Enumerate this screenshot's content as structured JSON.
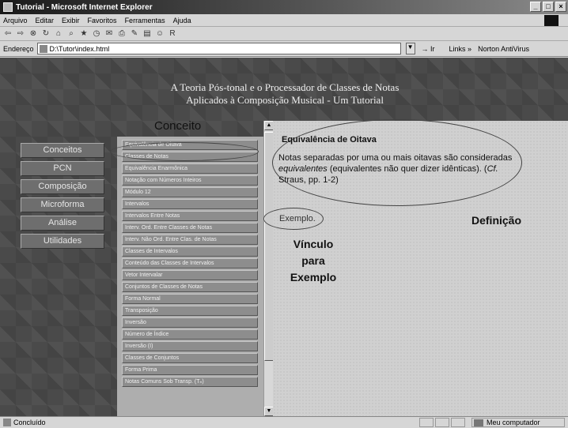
{
  "window": {
    "title": "Tutorial - Microsoft Internet Explorer",
    "controls": [
      "_",
      "□",
      "×"
    ]
  },
  "menu": [
    "Arquivo",
    "Editar",
    "Exibir",
    "Favoritos",
    "Ferramentas",
    "Ajuda"
  ],
  "toolbar": {
    "icons": [
      "back-icon",
      "forward-icon",
      "stop-icon",
      "refresh-icon",
      "home-icon",
      "search-icon",
      "favorites-icon",
      "history-icon",
      "mail-icon",
      "print-icon",
      "edit-icon",
      "discuss-icon",
      "messenger-icon",
      "research-icon"
    ]
  },
  "address": {
    "label": "Endereço",
    "url": "D:\\Tutor\\index.html",
    "go_label": "Ir",
    "links_label": "Links »",
    "norton_label": "Norton AntiVirus"
  },
  "page": {
    "title_line1": "A Teoria Pós-tonal e o Processador de Classes de Notas",
    "title_line2": "Aplicados à Composição Musical - Um Tutorial",
    "nav": [
      "Conceitos",
      "PCN",
      "Composição",
      "Microforma",
      "Análise",
      "Utilidades"
    ],
    "concept_heading": "Conceito",
    "concepts": [
      "Equivalência de Oitava",
      "Classes de Notas",
      "Equivalência Enarmônica",
      "Notação com Números Inteiros",
      "Módulo 12",
      "Intervalos",
      "Intervalos Entre Notas",
      "Interv. Ord. Entre Classes de Notas",
      "Interv. Não Ord. Entre Clas. de Notas",
      "Classes de Intervalos",
      "Conteúdo das Classes de Intervalos",
      "Vetor Intervalar",
      "Conjuntos de Classes de Notas",
      "Forma Normal",
      "Transposição",
      "Inversão",
      "Número de Índice",
      "Inversão (I)",
      "Classes de Conjuntos",
      "Forma Prima",
      "Notas Comuns Sob Transp. (Tₙ)"
    ],
    "definition": {
      "title": "Equivalência de Oitava",
      "text_before": "Notas separadas por uma ou mais oitavas são consideradas ",
      "text_italic": "equivalentes",
      "text_mid": " (equivalentes não quer dizer idênticas). (",
      "cf": "Cf.",
      "text_after": " Straus, pp. 1-2)",
      "example_link": "Exemplo.",
      "annotation_definition": "Definição",
      "annotation_link": "Vínculo para Exemplo"
    }
  },
  "status": {
    "text": "Concluído",
    "zone": "Meu computador"
  }
}
